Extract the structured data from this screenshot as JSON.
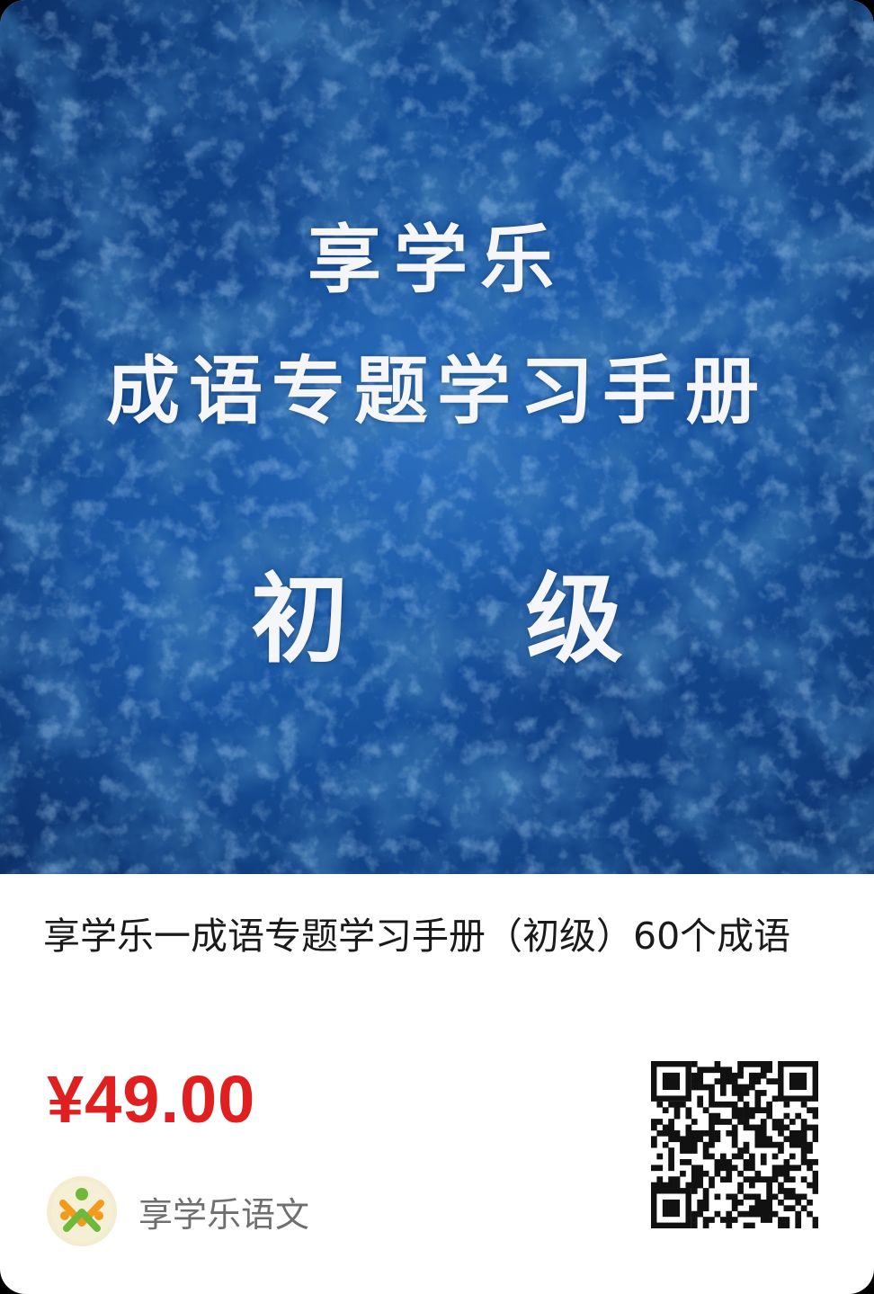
{
  "cover": {
    "brand": "享学乐",
    "title": "成语专题学习手册",
    "level": "初 级"
  },
  "product": {
    "title": "享学乐一成语专题学习手册（初级）60个成语",
    "price": "¥49.00",
    "store_name": "享学乐语文"
  },
  "colors": {
    "price": "#e02020",
    "cover_blue": "#154d95"
  },
  "icons": {
    "avatar": "store-logo-icon",
    "qr": "qr-code-icon"
  }
}
